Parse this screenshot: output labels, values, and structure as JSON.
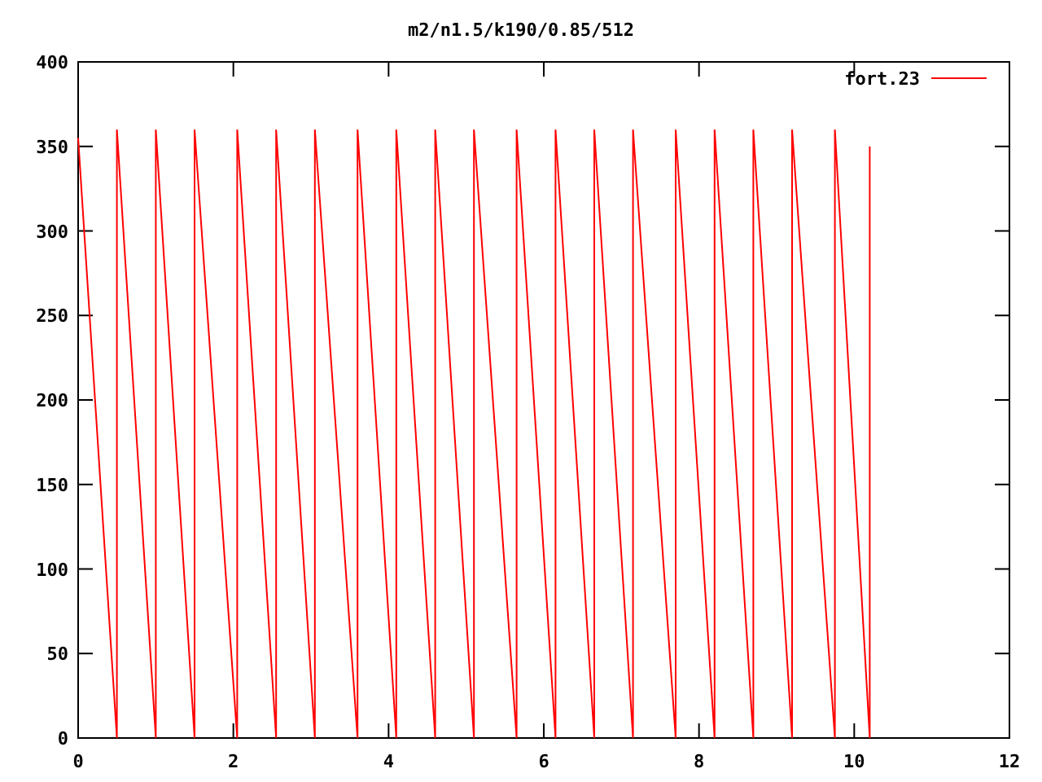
{
  "chart_data": {
    "type": "line",
    "title": "m2/n1.5/k190/0.85/512",
    "xlim": [
      0,
      12
    ],
    "ylim": [
      0,
      400
    ],
    "xticks": [
      0,
      2,
      4,
      6,
      8,
      10,
      12
    ],
    "yticks": [
      0,
      50,
      100,
      150,
      200,
      250,
      300,
      350,
      400
    ],
    "x": [
      0,
      0.5,
      0.5,
      1.0,
      1.0,
      1.5,
      1.5,
      2.05,
      2.05,
      2.55,
      2.55,
      3.05,
      3.05,
      3.6,
      3.6,
      4.1,
      4.1,
      4.6,
      4.6,
      5.1,
      5.1,
      5.65,
      5.65,
      6.15,
      6.15,
      6.65,
      6.65,
      7.15,
      7.15,
      7.7,
      7.7,
      8.2,
      8.2,
      8.7,
      8.7,
      9.2,
      9.2,
      9.75,
      9.75,
      10.2,
      10.2
    ],
    "series": [
      {
        "name": "fort.23",
        "color": "#ff0000",
        "values": [
          355,
          0,
          360,
          0,
          360,
          0,
          360,
          0,
          360,
          0,
          360,
          0,
          360,
          0,
          360,
          0,
          360,
          0,
          360,
          0,
          360,
          0,
          360,
          0,
          360,
          0,
          360,
          0,
          360,
          0,
          360,
          0,
          360,
          0,
          360,
          0,
          360,
          0,
          360,
          0,
          350
        ]
      }
    ]
  }
}
